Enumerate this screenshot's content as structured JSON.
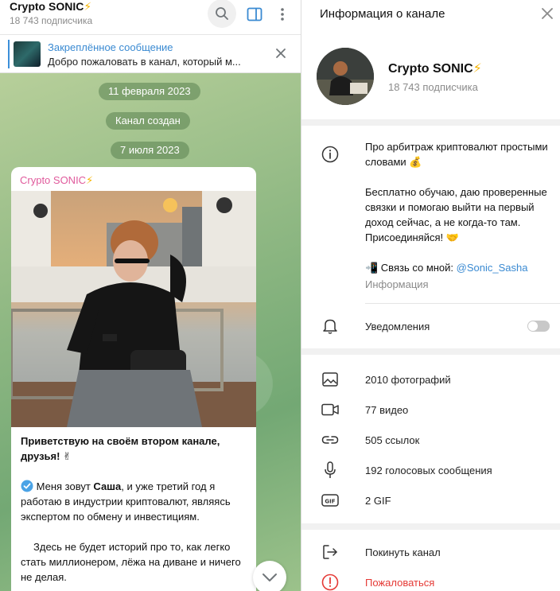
{
  "chat": {
    "title": "Crypto SONIC",
    "title_emoji": "⚡",
    "subscribers": "18 743 подписчика",
    "pinned": {
      "title": "Закреплённое сообщение",
      "text": "Добро пожаловать в канал, который м..."
    },
    "dates": [
      "11 февраля 2023",
      "Канал создан",
      "7 июля 2023"
    ],
    "message": {
      "author": "Crypto SONIC",
      "author_emoji": "⚡",
      "heading": "Приветствую на своём втором канале, друзья! ✌",
      "para1_prefix": "Меня зовут ",
      "para1_name": "Саша",
      "para1_suffix": ", и уже третий год я работаю в индустрии криптовалют, являясь экспертом по обмену и инвестициям.",
      "para2": "Здесь не будет историй про то, как легко стать миллионером, лёжа на диване и ничего не делая."
    }
  },
  "info": {
    "header_title": "Информация о канале",
    "channel_name": "Crypto SONIC",
    "channel_emoji": "⚡",
    "subscribers": "18 743 подписчика",
    "about": {
      "line1": "Про арбитраж криптовалют простыми словами 💰",
      "line2": "Бесплатно обучаю, даю проверенные связки и помогаю выйти на первый доход сейчас, а не когда-то там. Присоединяйся! 🤝",
      "contact_prefix": "📲 Связь со мной:",
      "contact_link": "@Sonic_Sasha",
      "label": "Информация"
    },
    "notifications_label": "Уведомления",
    "media": [
      {
        "icon": "photo-icon",
        "label": "2010 фотографий"
      },
      {
        "icon": "video-icon",
        "label": "77 видео"
      },
      {
        "icon": "link-icon",
        "label": "505 ссылок"
      },
      {
        "icon": "microphone-icon",
        "label": "192 голосовых сообщения"
      },
      {
        "icon": "gif-icon",
        "label": "2 GIF"
      }
    ],
    "leave_label": "Покинуть канал",
    "report_label": "Пожаловаться"
  }
}
